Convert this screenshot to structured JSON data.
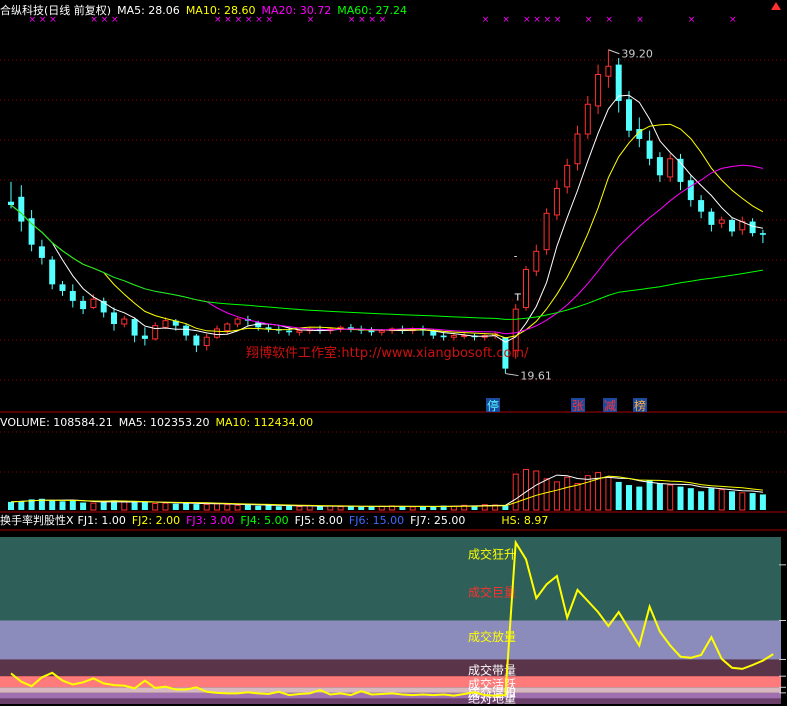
{
  "stock": {
    "name": "合纵科技",
    "period": "日线",
    "adjust": "前复权",
    "title": "合纵科技(日线 前复权)"
  },
  "price_legend": [
    {
      "label": "MA5: 28.06",
      "color": "#ffffff"
    },
    {
      "label": "MA10: 28.60",
      "color": "#ffff00"
    },
    {
      "label": "MA20: 30.72",
      "color": "#ff00ff"
    },
    {
      "label": "MA60: 27.24",
      "color": "#00ff00"
    }
  ],
  "volume_legend": [
    {
      "label": "VOLUME: 108584.21",
      "color": "#ffffff"
    },
    {
      "label": "MA5: 102353.20",
      "color": "#ffffff"
    },
    {
      "label": "MA10: 112434.00",
      "color": "#ffff00"
    }
  ],
  "turnover_legend": [
    {
      "label": "换手率判股性X",
      "color": "#ffffff"
    },
    {
      "label": "FJ1: 1.00",
      "color": "#ffffff"
    },
    {
      "label": "FJ2: 2.00",
      "color": "#ffff00"
    },
    {
      "label": "FJ3: 3.00",
      "color": "#ff00ff"
    },
    {
      "label": "FJ4: 5.00",
      "color": "#00ff00"
    },
    {
      "label": "FJ5: 8.00",
      "color": "#ffffff"
    },
    {
      "label": "FJ6: 15.00",
      "color": "#3c6cff"
    },
    {
      "label": "FJ7: 25.00",
      "color": "#ffffff"
    },
    {
      "label": "HS: 8.97",
      "color": "#ffff00"
    }
  ],
  "annotations": {
    "high_label": "39.20",
    "low_label": "19.61",
    "watermark": "翔博软件工作室:http://www.xiangbosoft.com/",
    "badges": [
      "停",
      "张",
      "减",
      "榜"
    ],
    "t_marker": "T",
    "dash_marker": "-",
    "x_marker": "×"
  },
  "zone_labels": [
    "成交狂升",
    "成交巨量",
    "成交放量",
    "成交带量",
    "成交活跃",
    "成交温和",
    "绝对地量"
  ],
  "colors": {
    "up": "#ff3030",
    "down": "#54ffff",
    "grid": "#8a0000",
    "ma5": "#ffffff",
    "ma10": "#ffff00",
    "ma20": "#ff00ff",
    "ma60": "#00ff00",
    "hs": "#ffff00"
  },
  "chart_data": [
    {
      "type": "candlestick",
      "title": "合纵科技(日线 前复权)",
      "ylim": [
        18,
        41
      ],
      "bars": [
        [
          30.0,
          31.2,
          29.8,
          29.6
        ],
        [
          30.3,
          31.0,
          28.8,
          28.2
        ],
        [
          29.0,
          29.5,
          27.4,
          27.0
        ],
        [
          27.3,
          27.7,
          26.6,
          26.2
        ],
        [
          26.5,
          26.7,
          25.0,
          24.7
        ],
        [
          25.0,
          25.2,
          24.6,
          24.3
        ],
        [
          24.6,
          25.0,
          24.0,
          23.6
        ],
        [
          24.0,
          24.3,
          23.5,
          23.2
        ],
        [
          23.6,
          24.4,
          24.1,
          23.5
        ],
        [
          24.0,
          24.2,
          23.3,
          23.0
        ],
        [
          23.3,
          23.6,
          22.6,
          22.2
        ],
        [
          22.6,
          23.1,
          22.9,
          22.4
        ],
        [
          22.9,
          23.0,
          21.9,
          21.5
        ],
        [
          21.9,
          22.4,
          21.7,
          21.3
        ],
        [
          21.7,
          22.7,
          22.5,
          21.6
        ],
        [
          22.4,
          23.0,
          22.8,
          22.3
        ],
        [
          22.8,
          22.9,
          22.5,
          22.2
        ],
        [
          22.5,
          22.6,
          21.9,
          21.6
        ],
        [
          21.9,
          22.0,
          21.3,
          20.9
        ],
        [
          21.3,
          22.0,
          21.8,
          21.0
        ],
        [
          21.8,
          22.5,
          22.3,
          21.7
        ],
        [
          22.2,
          22.7,
          22.6,
          22.0
        ],
        [
          22.6,
          23.0,
          22.9,
          22.4
        ],
        [
          22.9,
          23.1,
          22.8,
          22.5
        ],
        [
          22.7,
          22.8,
          22.4,
          22.2
        ],
        [
          22.4,
          22.6,
          22.3,
          22.1
        ],
        [
          22.3,
          22.5,
          22.2,
          22.0
        ],
        [
          22.2,
          22.4,
          22.1,
          21.9
        ],
        [
          22.1,
          22.3,
          22.2,
          21.9
        ],
        [
          22.2,
          22.4,
          22.3,
          22.0
        ],
        [
          22.3,
          22.5,
          22.2,
          22.0
        ],
        [
          22.2,
          22.4,
          22.3,
          22.0
        ],
        [
          22.3,
          22.5,
          22.4,
          22.1
        ],
        [
          22.4,
          22.6,
          22.3,
          22.1
        ],
        [
          22.3,
          22.5,
          22.2,
          22.0
        ],
        [
          22.2,
          22.4,
          22.1,
          21.9
        ],
        [
          22.1,
          22.3,
          22.2,
          21.9
        ],
        [
          22.2,
          22.4,
          22.3,
          22.0
        ],
        [
          22.3,
          22.5,
          22.2,
          22.0
        ],
        [
          22.2,
          22.4,
          22.3,
          22.0
        ],
        [
          22.3,
          22.5,
          22.2,
          21.9
        ],
        [
          22.2,
          22.3,
          21.9,
          21.7
        ],
        [
          21.9,
          22.1,
          21.8,
          21.6
        ],
        [
          21.8,
          22.0,
          21.9,
          21.6
        ],
        [
          21.9,
          22.1,
          21.9,
          21.7
        ],
        [
          21.9,
          22.0,
          21.8,
          21.6
        ],
        [
          21.8,
          22.0,
          21.9,
          21.6
        ],
        [
          21.9,
          22.1,
          22.0,
          21.7
        ],
        [
          21.8,
          21.8,
          19.9,
          19.6
        ],
        [
          21.0,
          23.8,
          23.5,
          20.5
        ],
        [
          23.6,
          26.1,
          25.9,
          23.4
        ],
        [
          25.8,
          27.4,
          27.0,
          25.5
        ],
        [
          27.1,
          29.6,
          29.3,
          26.8
        ],
        [
          29.2,
          31.3,
          30.8,
          28.9
        ],
        [
          30.9,
          32.6,
          32.2,
          30.5
        ],
        [
          32.3,
          34.6,
          34.1,
          31.9
        ],
        [
          34.1,
          36.4,
          35.9,
          33.8
        ],
        [
          35.8,
          38.3,
          37.7,
          35.3
        ],
        [
          37.6,
          39.2,
          38.2,
          36.9
        ],
        [
          38.3,
          38.7,
          36.1,
          35.4
        ],
        [
          36.2,
          36.7,
          34.3,
          33.9
        ],
        [
          34.4,
          35.1,
          33.8,
          33.3
        ],
        [
          33.7,
          34.3,
          32.6,
          32.2
        ],
        [
          32.7,
          33.0,
          31.6,
          31.2
        ],
        [
          31.5,
          32.9,
          32.6,
          31.2
        ],
        [
          32.6,
          32.9,
          31.2,
          30.7
        ],
        [
          31.3,
          31.6,
          30.1,
          29.7
        ],
        [
          30.1,
          30.4,
          29.4,
          29.0
        ],
        [
          29.4,
          29.6,
          28.6,
          28.2
        ],
        [
          28.7,
          29.1,
          28.9,
          28.4
        ],
        [
          28.9,
          29.0,
          28.2,
          27.9
        ],
        [
          28.3,
          29.1,
          28.8,
          28.0
        ],
        [
          28.8,
          29.0,
          28.1,
          27.9
        ],
        [
          28.1,
          28.3,
          28.0,
          27.5
        ]
      ],
      "high_label": "39.20",
      "low_label": "19.61",
      "series": [
        {
          "name": "MA5",
          "last": 28.06
        },
        {
          "name": "MA10",
          "last": 28.6
        },
        {
          "name": "MA20",
          "last": 30.72
        },
        {
          "name": "MA60",
          "last": 27.24
        }
      ]
    },
    {
      "type": "bar",
      "ylim": [
        0,
        500000
      ],
      "values": [
        52000,
        58000,
        68000,
        72000,
        64000,
        56000,
        60000,
        48000,
        44000,
        50000,
        62000,
        54000,
        48000,
        52000,
        42000,
        44000,
        40000,
        46000,
        38000,
        36000,
        40000,
        34000,
        30000,
        36000,
        28000,
        30000,
        24000,
        26000,
        22000,
        28000,
        24000,
        26000,
        22000,
        24000,
        20000,
        22000,
        24000,
        26000,
        22000,
        20000,
        24000,
        22000,
        28000,
        24000,
        30000,
        26000,
        34000,
        32000,
        28000,
        230000,
        260000,
        250000,
        200000,
        180000,
        210000,
        170000,
        220000,
        240000,
        210000,
        180000,
        160000,
        150000,
        190000,
        170000,
        160000,
        150000,
        140000,
        120000,
        140000,
        130000,
        120000,
        110000,
        108584,
        100000
      ],
      "series": [
        {
          "name": "VOLUME",
          "last": 108584.21
        },
        {
          "name": "MA5",
          "last": 102353.2
        },
        {
          "name": "MA10",
          "last": 112434.0
        }
      ]
    },
    {
      "type": "line",
      "title": "换手率判股性X",
      "ylim": [
        0,
        25
      ],
      "levels": {
        "FJ1": 1.0,
        "FJ2": 2.0,
        "FJ3": 3.0,
        "FJ4": 5.0,
        "FJ5": 8.0,
        "FJ6": 15.0,
        "FJ7": 25.0
      },
      "series": [
        {
          "name": "HS",
          "last": 8.97,
          "values": [
            5.5,
            4.0,
            3.2,
            4.8,
            5.6,
            4.2,
            3.5,
            3.9,
            4.6,
            3.7,
            3.4,
            3.3,
            2.8,
            4.2,
            2.9,
            3.1,
            2.6,
            2.6,
            3.0,
            2.2,
            2.0,
            1.9,
            1.9,
            2.1,
            1.9,
            1.8,
            2.2,
            1.6,
            1.8,
            1.9,
            2.5,
            1.7,
            1.9,
            1.6,
            2.3,
            1.7,
            1.8,
            1.9,
            1.7,
            1.6,
            1.7,
            1.6,
            1.7,
            1.5,
            1.8,
            2.1,
            1.6,
            1.5,
            1.6,
            29.0,
            26.0,
            19.0,
            21.5,
            23.0,
            15.5,
            20.5,
            18.5,
            16.5,
            14.0,
            16.5,
            13.5,
            10.5,
            17.5,
            13.0,
            10.5,
            8.5,
            8.3,
            8.8,
            12.0,
            8.1,
            6.5,
            6.3,
            7.0,
            7.8,
            8.97
          ]
        }
      ]
    }
  ]
}
